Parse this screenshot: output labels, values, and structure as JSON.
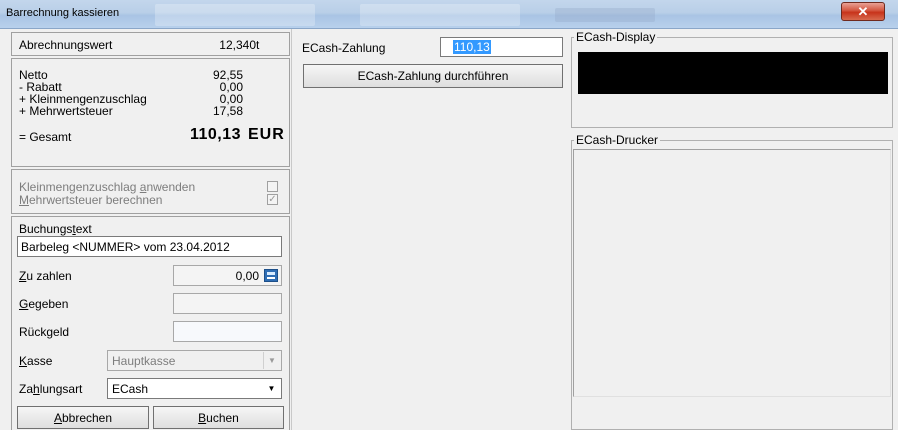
{
  "window": {
    "title": "Barrechnung kassieren",
    "close_glyph": "✕"
  },
  "summary": {
    "abrechnungswert_label": "Abrechnungswert",
    "abrechnungswert_value": "12,340",
    "abrechnungswert_unit": "t",
    "netto_label": "Netto",
    "netto_value": "92,55",
    "rabatt_label": "- Rabatt",
    "rabatt_value": "0,00",
    "klein_label": "+ Kleinmengenzuschlag",
    "klein_value": "0,00",
    "mwst_label": "+ Mehrwertsteuer",
    "mwst_value": "17,58",
    "gesamt_label": "= Gesamt",
    "gesamt_value": "110,13",
    "gesamt_currency": "EUR"
  },
  "options": {
    "klein_prefix": "Kleinmengenzuschlag ",
    "klein_hotkey": "a",
    "klein_suffix": "nwenden",
    "klein_checked": false,
    "mwst_hotkey": "M",
    "mwst_suffix": "ehrwertsteuer berechnen",
    "mwst_checked": true
  },
  "booking": {
    "buchungstext_prefix": "Buchungs",
    "buchungstext_hotkey": "t",
    "buchungstext_suffix": "ext",
    "buchungstext_value": "Barbeleg <NUMMER> vom 23.04.2012",
    "zu_zahlen_hotkey": "Z",
    "zu_zahlen_suffix": "u zahlen",
    "zu_zahlen_value": "0,00",
    "gegeben_hotkey": "G",
    "gegeben_suffix": "egeben",
    "gegeben_value": "",
    "rueckgeld_label": "Rückgeld",
    "rueckgeld_value": "",
    "kasse_hotkey": "K",
    "kasse_suffix": "asse",
    "kasse_value": "Hauptkasse",
    "zahlungsart_prefix": "Za",
    "zahlungsart_hotkey": "h",
    "zahlungsart_suffix": "lungsart",
    "zahlungsart_value": "ECash"
  },
  "buttons": {
    "abbrechen_hotkey": "A",
    "abbrechen_suffix": "bbrechen",
    "buchen_hotkey": "B",
    "buchen_suffix": "uchen"
  },
  "ecash": {
    "zahlung_label": "ECash-Zahlung",
    "zahlung_value": "110,13",
    "durchfuehren_label": "ECash-Zahlung durchführen",
    "display_legend": "ECash-Display",
    "drucker_legend": "ECash-Drucker"
  },
  "colors": {
    "title_bar": "#b9cfe8",
    "close_button": "#c7331b",
    "display_background": "#000000",
    "selection_highlight": "#3399ff"
  }
}
